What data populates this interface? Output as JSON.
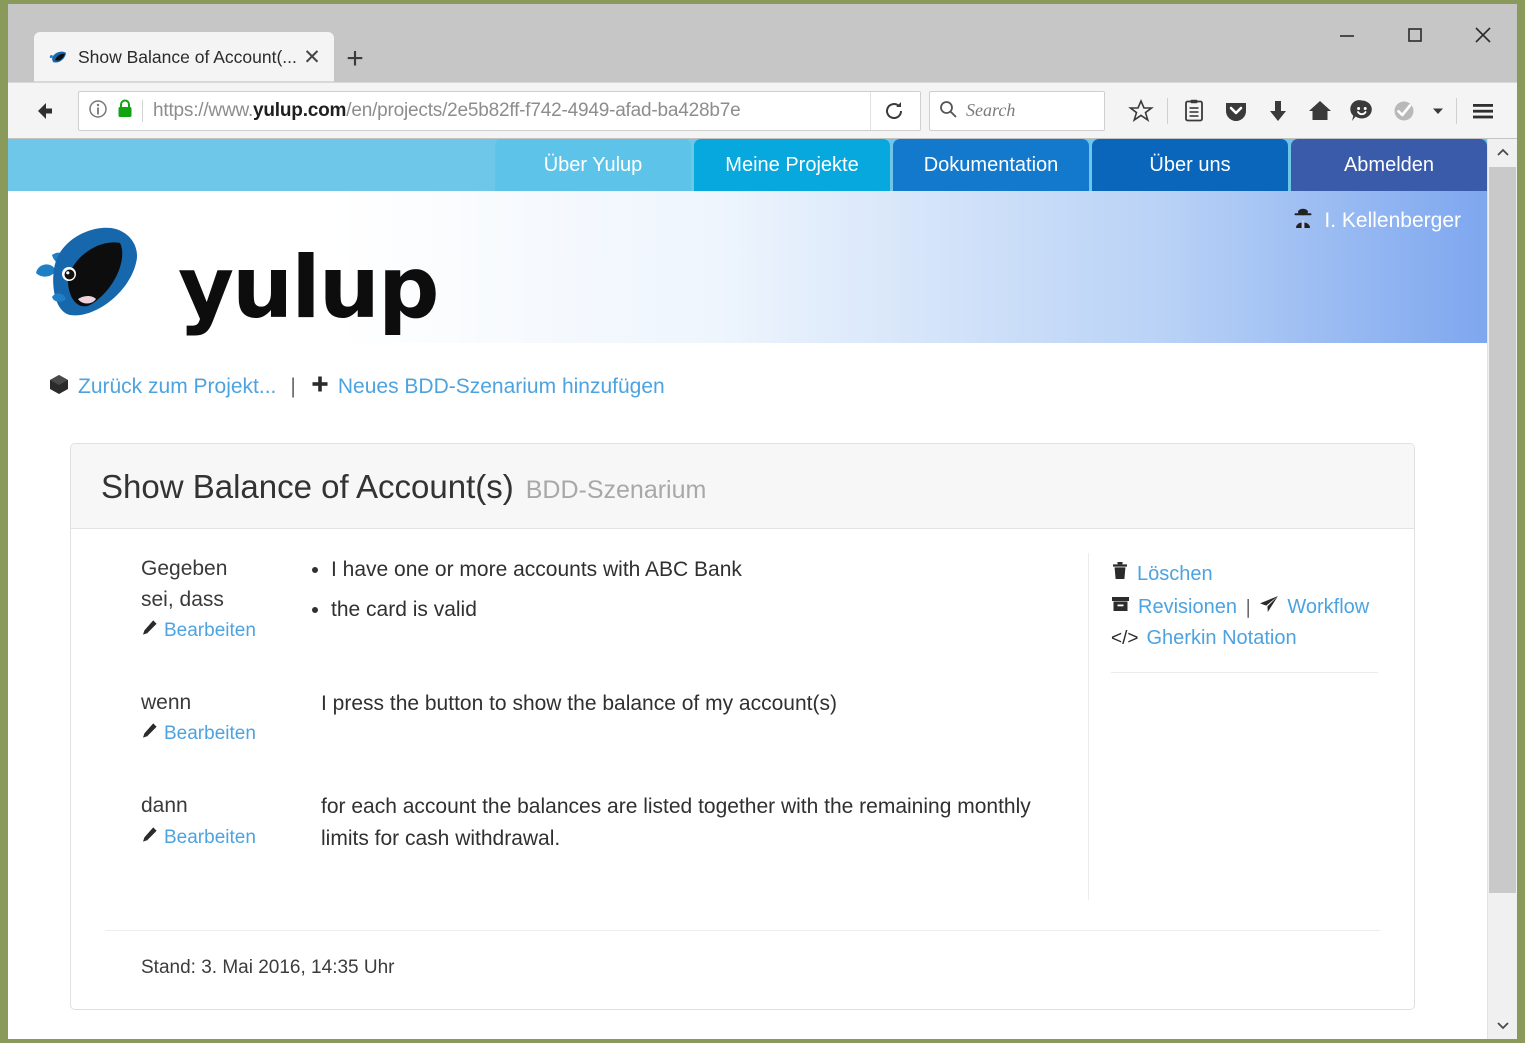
{
  "browser": {
    "tab": {
      "title": "Show Balance of Account(...",
      "favicon": "yulup-whale-favicon",
      "close": "✕"
    },
    "newtab_label": "+",
    "window_controls": {
      "minimize": "minimize-icon",
      "maximize": "maximize-icon",
      "close": "close-icon"
    },
    "url": {
      "scheme": "https://www.",
      "domain": "yulup.com",
      "path": "/en/projects/2e5b82ff-f742-4949-afad-ba428b7e",
      "full": "https://www.yulup.com/en/projects/2e5b82ff-f742-4949-afad-ba428b7e"
    },
    "search": {
      "placeholder": "Search"
    },
    "toolbar_icons": [
      "bookmark-star-icon",
      "reader-list-icon",
      "pocket-icon",
      "downloads-icon",
      "home-icon",
      "smiley-feedback-icon",
      "checkmark-badge-icon",
      "overflow-chevron-icon",
      "hamburger-menu-icon"
    ]
  },
  "site": {
    "nav": [
      {
        "label": "Über Yulup",
        "color": "#5ec3e8"
      },
      {
        "label": "Meine Projekte",
        "color": "#06a8dd"
      },
      {
        "label": "Dokumentation",
        "color": "#1279cd"
      },
      {
        "label": "Über uns",
        "color": "#0a66bb"
      },
      {
        "label": "Abmelden",
        "color": "#3a5ba9"
      }
    ],
    "logo_word": "yulup",
    "user": {
      "name": "I. Kellenberger",
      "icon": "user-secret-icon"
    },
    "breadcrumb": {
      "back_label": "Zurück zum Projekt...",
      "back_icon": "cube-icon",
      "separator": "|",
      "add_label": "Neues BDD-Szenarium hinzufügen",
      "add_icon": "plus-icon"
    }
  },
  "card": {
    "title": "Show Balance of Account(s)",
    "subtitle": "BDD-Szenarium",
    "rows": [
      {
        "label": "Gegeben",
        "label2": "sei, dass",
        "edit_label": "Bearbeiten",
        "edit_icon": "pencil-icon",
        "bullets": [
          "I have one or more accounts with ABC Bank",
          "the card is valid"
        ],
        "text": ""
      },
      {
        "label": "wenn",
        "label2": "",
        "edit_label": "Bearbeiten",
        "edit_icon": "pencil-icon",
        "bullets": [],
        "text": "I press the button to show the balance of my account(s)"
      },
      {
        "label": "dann",
        "label2": "",
        "edit_label": "Bearbeiten",
        "edit_icon": "pencil-icon",
        "bullets": [],
        "text": "for each account the balances are listed together with the remaining monthly limits for cash withdrawal."
      }
    ],
    "actions": {
      "delete": {
        "label": "Löschen",
        "icon": "trash-icon"
      },
      "revisions": {
        "label": "Revisionen",
        "icon": "archive-icon"
      },
      "pipe": "|",
      "workflow": {
        "label": "Workflow",
        "icon": "paper-plane-icon"
      },
      "gherkin": {
        "label": "Gherkin Notation",
        "icon": "code-icon"
      }
    },
    "footer": "Stand: 3. Mai 2016, 14:35 Uhr"
  },
  "colors": {
    "link": "#4da3e0",
    "brand_blue": "#1267ae",
    "nav_strip": "#6ec6e8"
  }
}
